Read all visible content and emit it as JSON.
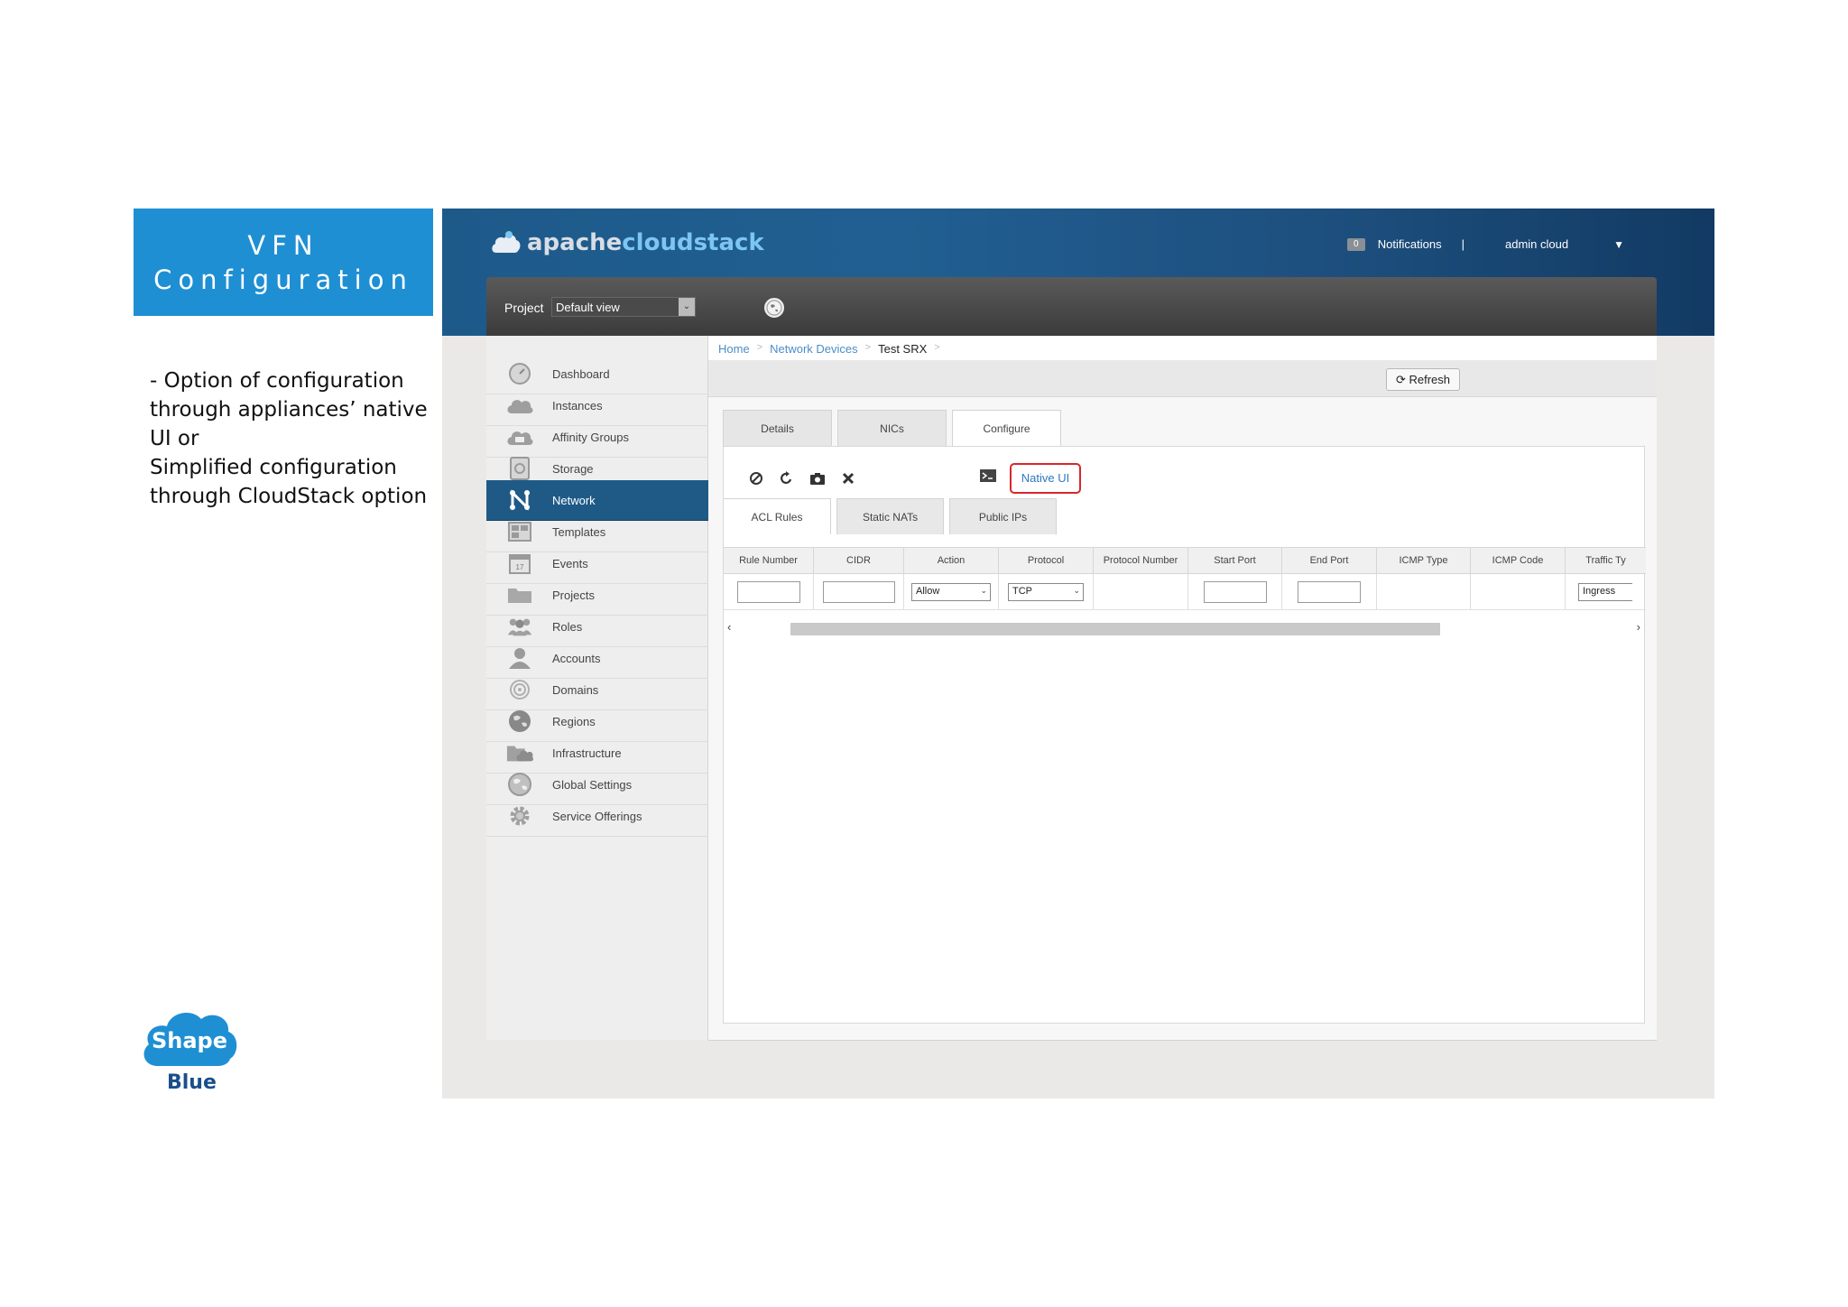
{
  "slide": {
    "title_line1": "VFN",
    "title_line2": "Configuration",
    "description": [
      "- Option of configuration",
      "through appliances’ native",
      "UI or",
      "Simplified configuration",
      "through CloudStack option"
    ],
    "logo_line1": "Shape",
    "logo_line2": "Blue"
  },
  "header": {
    "brand_part1": "apache",
    "brand_part2": "cloudstack",
    "notif_count": "0",
    "notifications_label": "Notifications",
    "separator": "|",
    "user": "admin cloud",
    "user_caret": "▼"
  },
  "project_bar": {
    "label": "Project",
    "selected": "Default view"
  },
  "sidebar": {
    "items": [
      {
        "label": "Dashboard",
        "icon": "dashboard-icon"
      },
      {
        "label": "Instances",
        "icon": "cloud-icon"
      },
      {
        "label": "Affinity Groups",
        "icon": "affinity-icon"
      },
      {
        "label": "Storage",
        "icon": "storage-icon"
      },
      {
        "label": "Network",
        "icon": "network-icon",
        "active": true
      },
      {
        "label": "Templates",
        "icon": "templates-icon"
      },
      {
        "label": "Events",
        "icon": "calendar-icon"
      },
      {
        "label": "Projects",
        "icon": "folder-icon"
      },
      {
        "label": "Roles",
        "icon": "roles-icon"
      },
      {
        "label": "Accounts",
        "icon": "user-icon"
      },
      {
        "label": "Domains",
        "icon": "domains-icon"
      },
      {
        "label": "Regions",
        "icon": "globe-icon"
      },
      {
        "label": "Infrastructure",
        "icon": "infrastructure-icon"
      },
      {
        "label": "Global Settings",
        "icon": "global-settings-icon"
      },
      {
        "label": "Service Offerings",
        "icon": "gear-icon"
      }
    ]
  },
  "breadcrumb": {
    "home": "Home",
    "network_devices": "Network Devices",
    "current": "Test SRX",
    "arrow": ">"
  },
  "toolbar": {
    "refresh_label": "Refresh"
  },
  "tabs": [
    "Details",
    "NICs",
    "Configure"
  ],
  "active_tab": "Configure",
  "configure": {
    "native_ui_label": "Native UI",
    "subtabs": [
      "ACL Rules",
      "Static NATs",
      "Public IPs"
    ],
    "active_subtab": "ACL Rules",
    "columns": [
      "Rule Number",
      "CIDR",
      "Action",
      "Protocol",
      "Protocol Number",
      "Start Port",
      "End Port",
      "ICMP Type",
      "ICMP Code",
      "Traffic Ty"
    ],
    "action_value": "Allow",
    "protocol_value": "TCP",
    "traffic_value": "Ingress"
  },
  "colors": {
    "accent_blue": "#1f8fd3",
    "header_blue": "#1d5a8a",
    "active_nav": "#1f5a86",
    "native_ui_border": "#d8262c"
  }
}
